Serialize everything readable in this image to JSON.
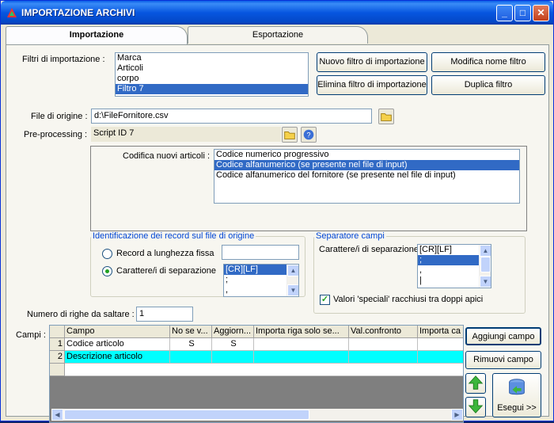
{
  "window": {
    "title": "IMPORTAZIONE ARCHIVI",
    "min": "_",
    "max": "□",
    "close": "✕"
  },
  "tabs": [
    {
      "label": "Importazione"
    },
    {
      "label": "Esportazione"
    }
  ],
  "filters": {
    "label": "Filtri di importazione :",
    "items": [
      "Marca",
      "Articoli",
      "corpo",
      "Filtro 7"
    ],
    "selected_index": 3,
    "buttons": {
      "new": "Nuovo filtro di importazione",
      "rename": "Modifica nome filtro",
      "delete": "Elimina filtro di importazione",
      "duplicate": "Duplica filtro"
    }
  },
  "source_file": {
    "label": "File di origine :",
    "value": "d:\\FileFornitore.csv"
  },
  "preprocessing": {
    "label": "Pre-processing :",
    "value": "Script ID 7"
  },
  "encoding": {
    "label": "Codifica nuovi articoli :",
    "items": [
      "Codice numerico progressivo",
      "Codice alfanumerico (se presente nel file di input)",
      "Codice alfanumerico del fornitore (se presente nel file di input)"
    ],
    "selected_index": 1
  },
  "record_id": {
    "legend": "Identificazione dei record sul file di origine",
    "fixed_label": "Record a lunghezza fissa",
    "sep_label": "Carattere/i di separazione",
    "sep_items": [
      "[CR][LF]",
      ";",
      ","
    ],
    "selected": "sep"
  },
  "field_sep": {
    "legend": "Separatore campi",
    "label": "Carattere/i di separazione",
    "items": [
      "[CR][LF]",
      ";",
      ",",
      "|"
    ],
    "special_label": "Valori 'speciali' racchiusi tra doppi apici",
    "special_checked": true
  },
  "skip_rows": {
    "label": "Numero di righe da saltare :",
    "value": "1"
  },
  "fields": {
    "label": "Campi :",
    "columns": [
      "Campo",
      "No se v...",
      "Aggiorn...",
      "Importa riga solo se...",
      "Val.confronto",
      "Importa ca"
    ],
    "rows": [
      {
        "n": "1",
        "campo": "Codice articolo",
        "no": "S",
        "agg": "S",
        "imp": "",
        "val": "",
        "ic": ""
      },
      {
        "n": "2",
        "campo": "Descrizione articolo",
        "no": "",
        "agg": "",
        "imp": "",
        "val": "",
        "ic": ""
      }
    ],
    "buttons": {
      "add": "Aggiungi campo",
      "remove": "Rimuovi campo",
      "run": "Esegui >>"
    }
  }
}
